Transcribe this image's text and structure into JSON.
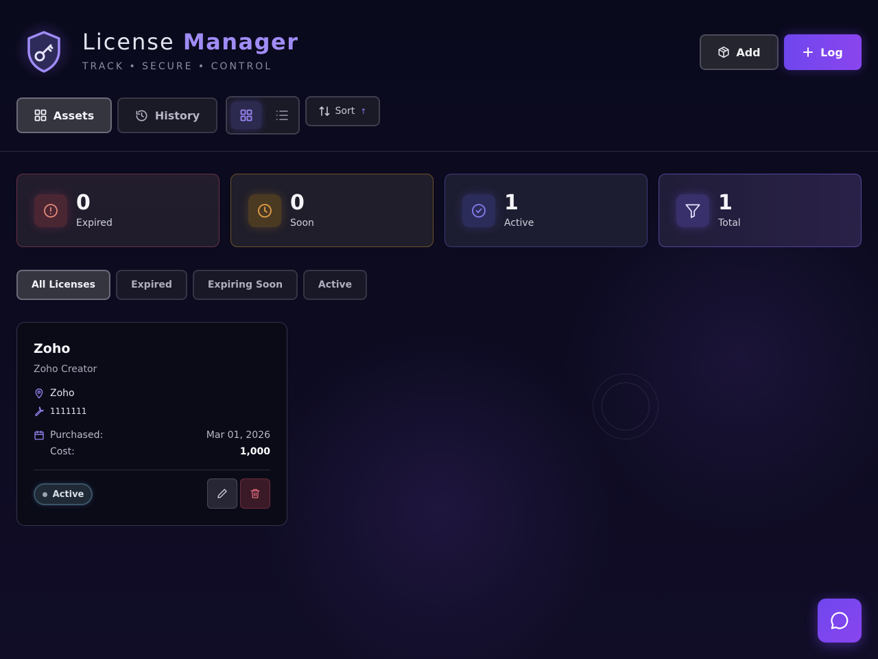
{
  "header": {
    "title_part1": "License",
    "title_part2": "Manager",
    "subtitle": "TRACK • SECURE • CONTROL",
    "logo_icon": "shield-key-icon"
  },
  "actions": {
    "add_label": "Add",
    "log_label": "Log"
  },
  "nav": {
    "tabs": [
      {
        "label": "Assets",
        "icon": "grid-icon",
        "active": true
      },
      {
        "label": "History",
        "icon": "history-icon",
        "active": false
      }
    ],
    "view_mode": "grid",
    "sort_label": "Sort",
    "sort_direction": "ascending"
  },
  "stats": [
    {
      "value": "0",
      "label": "Expired",
      "icon": "alert-circle-icon",
      "color": "#e0607a"
    },
    {
      "value": "0",
      "label": "Soon",
      "icon": "clock-icon",
      "color": "#e8a04a"
    },
    {
      "value": "1",
      "label": "Active",
      "icon": "check-circle-icon",
      "color": "#8a7ef0"
    },
    {
      "value": "1",
      "label": "Total",
      "icon": "filter-icon",
      "color": "#b9a8f8"
    }
  ],
  "filters": {
    "items": [
      "All Licenses",
      "Expired",
      "Expiring Soon",
      "Active"
    ],
    "selected": "All Licenses"
  },
  "licenses": [
    {
      "name": "Zoho",
      "product": "Zoho Creator",
      "vendor": "Zoho",
      "key": "1111111",
      "purchased_label": "Purchased:",
      "purchased": "Mar 01, 2026",
      "cost_label": "Cost:",
      "cost": "1,000",
      "status": "Active"
    }
  ],
  "colors": {
    "accent": "#7c4dff",
    "background": "#0b0b1c"
  },
  "chat": {
    "icon": "chat-bubble-icon"
  }
}
